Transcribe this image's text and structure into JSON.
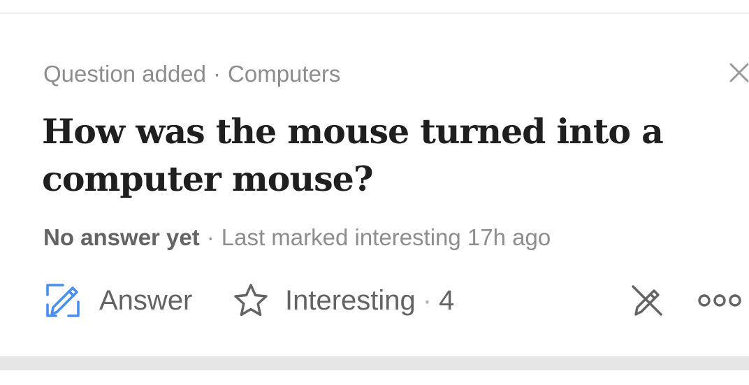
{
  "feed_item": {
    "meta": {
      "action": "Question added",
      "separator": "·",
      "topic": "Computers"
    },
    "title": "How was the mouse turned into a computer mouse?",
    "status": {
      "answer_state": "No answer yet",
      "separator": "·",
      "activity": "Last marked interesting 17h ago"
    },
    "actions": {
      "answer_label": "Answer",
      "interesting_label": "Interesting",
      "separator": "·",
      "interesting_count": "4"
    },
    "icons": {
      "close": "close-icon",
      "answer": "edit-pencil-icon",
      "interesting": "star-icon",
      "pass": "pencil-crossed-icon",
      "more": "more-dots-icon"
    },
    "colors": {
      "title": "#1f1f1f",
      "meta_text": "#8d8d8d",
      "action_text": "#636363",
      "answer_icon": "#4a8ff0",
      "divider": "#e6e6e6"
    }
  }
}
